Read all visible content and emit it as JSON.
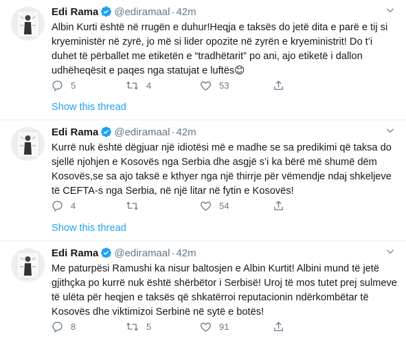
{
  "tweets": [
    {
      "name": "Edi Rama",
      "handle": "@ediramaal",
      "time": "42m",
      "text": "Albin Kurti është në rrugën e duhur!Heqja e taksës do jetë dita e parë e tij si kryeministër në zyrë, jo më si lider opozite në zyrën e kryeministrit! Do t’i duhet të përballet me etiketën e “tradhëtarit” po ani, ajo etiketë i dallon udhëheqësit e paqes nga statujat e luftës😊",
      "replies": "5",
      "retweets": "4",
      "likes": "53",
      "thread": "Show this thread"
    },
    {
      "name": "Edi Rama",
      "handle": "@ediramaal",
      "time": "42m",
      "text": "Kurrë nuk është dëgjuar një idiotësi më e madhe se sa predikimi që taksa do sjellë njohjen e Kosovës nga Serbia dhe asgjë s’i ka bërë më shumë dëm Kosovës,se sa ajo taksë e kthyer nga një thirrje për vëmendje ndaj shkeljeve të CEFTA-s nga Serbia, në një litar në fytin e Kosovës!",
      "replies": "4",
      "retweets": "",
      "likes": "54",
      "thread": "Show this thread"
    },
    {
      "name": "Edi Rama",
      "handle": "@ediramaal",
      "time": "42m",
      "text": "Me paturpësi Ramushi ka nisur baltosjen e Albin Kurtit! Albini mund të jetë gjithçka po kurrë nuk është shërbëtor i Serbisë! Uroj të mos tutet prej sulmeve të ulëta për heqjen e taksës që shkatërroi reputacionin ndërkombëtar të Kosovës dhe viktimizoi Serbinë në sytë e botës!",
      "replies": "8",
      "retweets": "5",
      "likes": "91",
      "thread": ""
    }
  ],
  "icons": [
    "avatar",
    "verified-badge-icon",
    "caret-down-icon",
    "reply-icon",
    "retweet-icon",
    "like-icon",
    "share-icon"
  ],
  "colors": {
    "link": "#1da1f2",
    "muted": "#657786",
    "text": "#14171a",
    "divider": "#e6ecf0"
  }
}
